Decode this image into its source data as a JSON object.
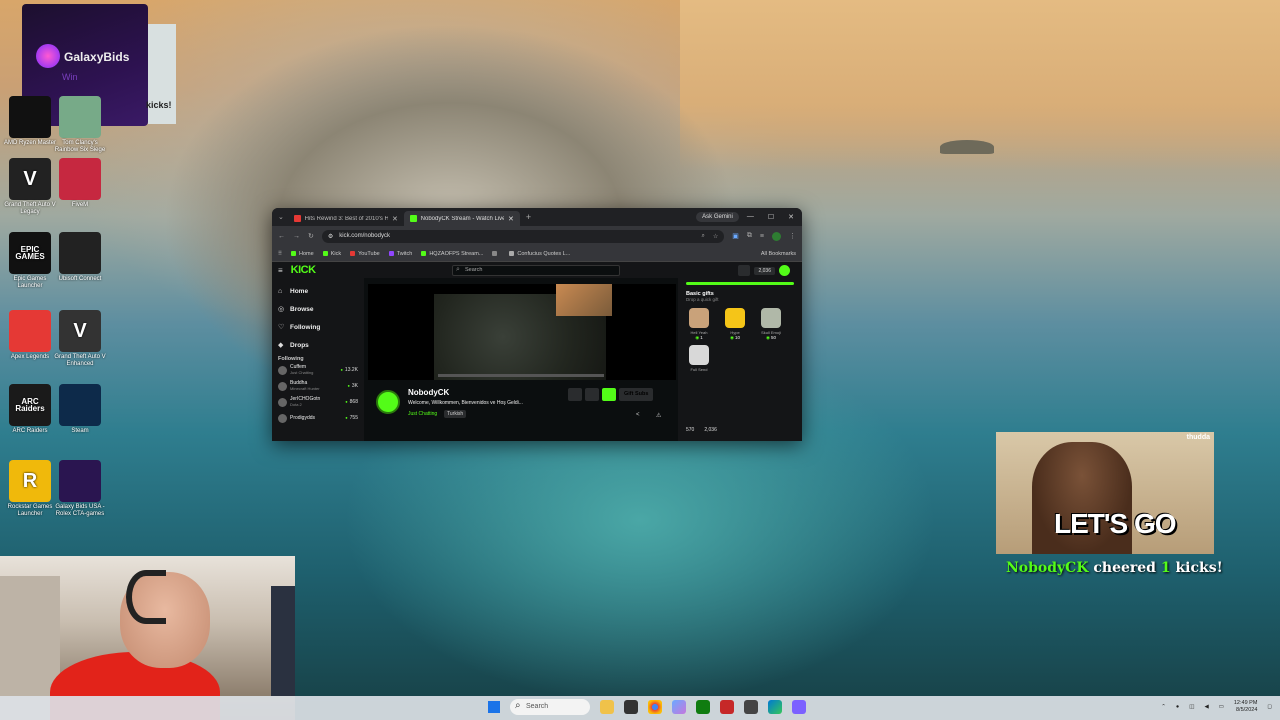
{
  "desktop": {
    "icons": [
      {
        "label": "AMD Ryzen Master",
        "badge": ""
      },
      {
        "label": "Tom Clancy's Rainbow Six Siege",
        "badge": ""
      },
      {
        "label": "Grand Theft Auto V Legacy",
        "badge": "V"
      },
      {
        "label": "FiveM",
        "badge": ""
      },
      {
        "label": "Epic Games Launcher",
        "badge": "EPIC GAMES"
      },
      {
        "label": "Ubisoft Connect",
        "badge": ""
      },
      {
        "label": "Apex Legends",
        "badge": ""
      },
      {
        "label": "Grand Theft Auto V Enhanced",
        "badge": "V"
      },
      {
        "label": "ARC Raiders",
        "badge": "ARC Raiders"
      },
      {
        "label": "Steam",
        "badge": ""
      },
      {
        "label": "Rockstar Games Launcher",
        "badge": "R"
      },
      {
        "label": "Galaxy Bids USA - Rolex CTA-games",
        "badge": ""
      }
    ],
    "galaxy_widget": {
      "name": "GalaxyBids",
      "sub": "Win",
      "side_text": "kicks!"
    }
  },
  "browser": {
    "tabs": [
      {
        "title": "Hits Rewind 3: Best of 2010's H",
        "color": "#e53935",
        "active": false
      },
      {
        "title": "NobodyCK Stream - Watch Live",
        "color": "#53fc18",
        "active": true
      }
    ],
    "gemini": "Ask Gemini",
    "url": "kick.com/nobodyck",
    "bookmarks": [
      {
        "label": "Home",
        "color": "#53fc18"
      },
      {
        "label": "Kick",
        "color": "#53fc18"
      },
      {
        "label": "YouTube",
        "color": "#e53935"
      },
      {
        "label": "Twitch",
        "color": "#9146ff"
      },
      {
        "label": "HQZAOFPS Stream...",
        "color": "#53fc18"
      },
      {
        "label": "",
        "color": "#888888"
      },
      {
        "label": "Confucius Quotes L...",
        "color": "#aaaaaa"
      }
    ],
    "all_bookmarks": "All Bookmarks"
  },
  "kick": {
    "logo": "KICK",
    "search_placeholder": "Search",
    "coins": "2,036",
    "nav": [
      {
        "label": "Home",
        "icon": "⌂"
      },
      {
        "label": "Browse",
        "icon": "◎"
      },
      {
        "label": "Following",
        "icon": "♡"
      },
      {
        "label": "Drops",
        "icon": "◆"
      }
    ],
    "following_header": "Following",
    "following": [
      {
        "name": "Cuffem",
        "cat": "Just Chatting",
        "count": "13.2K"
      },
      {
        "name": "Buddha",
        "cat": "Minecraft Hunter",
        "count": "3K"
      },
      {
        "name": "JerICHOGotn",
        "cat": "Dota 2",
        "count": "868"
      },
      {
        "name": "Prodigydds",
        "cat": "",
        "count": "755"
      }
    ],
    "streamer": {
      "name": "NobodyCK",
      "title": "Welcome, Willkommen, Bienvenidos ve Hoş Geldi...",
      "category": "Just Chatting",
      "tag": "Turkish",
      "gift_subs": "Gift Subs"
    },
    "gifts": {
      "header": "Basic gifts",
      "sub": "Drop a quick gift",
      "items": [
        {
          "name": "Hell Yeah",
          "price": "1",
          "color": "#c9a27a"
        },
        {
          "name": "Hype",
          "price": "10",
          "color": "#f5c518"
        },
        {
          "name": "Skull Emoji",
          "price": "50",
          "color": "#b0b8a8"
        },
        {
          "name": "Full Send",
          "price": "",
          "color": "#d8d8d8"
        }
      ],
      "footer_left": "570",
      "footer_right": "2,036"
    }
  },
  "overlay": {
    "alert_brand": "thudda",
    "alert_text": "LET'S GO",
    "cheer_user": "NobodyCK",
    "cheer_mid": " cheered ",
    "cheer_amount": "1",
    "cheer_end": " kicks!"
  },
  "taskbar": {
    "search_placeholder": "Search",
    "time": "12:49 PM",
    "date": "8/5/2024"
  }
}
